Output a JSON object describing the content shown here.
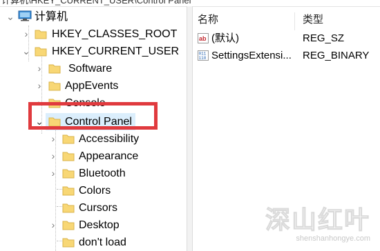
{
  "address_bar": {
    "path": "计算机\\HKEY_CURRENT_USER\\Control Panel"
  },
  "tree": {
    "root": {
      "label": "计算机",
      "icon": "computer-icon",
      "expanded": true
    },
    "items": [
      {
        "label": "HKEY_CLASSES_ROOT",
        "expanded": false,
        "has_children": true
      },
      {
        "label": "HKEY_CURRENT_USER",
        "expanded": true,
        "has_children": true
      },
      {
        "label": "Software",
        "has_children": true
      },
      {
        "label": "AppEvents",
        "has_children": true
      },
      {
        "label": "Console",
        "has_children": true
      },
      {
        "label": "Control Panel",
        "expanded": true,
        "selected": true,
        "has_children": true
      },
      {
        "label": "Accessibility",
        "has_children": true
      },
      {
        "label": "Appearance",
        "has_children": true
      },
      {
        "label": "Bluetooth",
        "has_children": true
      },
      {
        "label": "Colors",
        "has_children": false
      },
      {
        "label": "Cursors",
        "has_children": false
      },
      {
        "label": "Desktop",
        "has_children": true
      },
      {
        "label": "don't load",
        "has_children": false
      }
    ]
  },
  "values_list": {
    "columns": [
      "名称",
      "类型"
    ],
    "rows": [
      {
        "name": "(默认)",
        "type": "REG_SZ",
        "icon": "string-value-icon"
      },
      {
        "name": "SettingsExtensi...",
        "type": "REG_BINARY",
        "icon": "binary-value-icon"
      }
    ]
  },
  "watermark": {
    "title": "深山红叶",
    "url": "shenshanhongye.com"
  },
  "colors": {
    "highlight_box": "#e03a3e",
    "folder": "#f8d775",
    "selection": "#dbeefc"
  }
}
